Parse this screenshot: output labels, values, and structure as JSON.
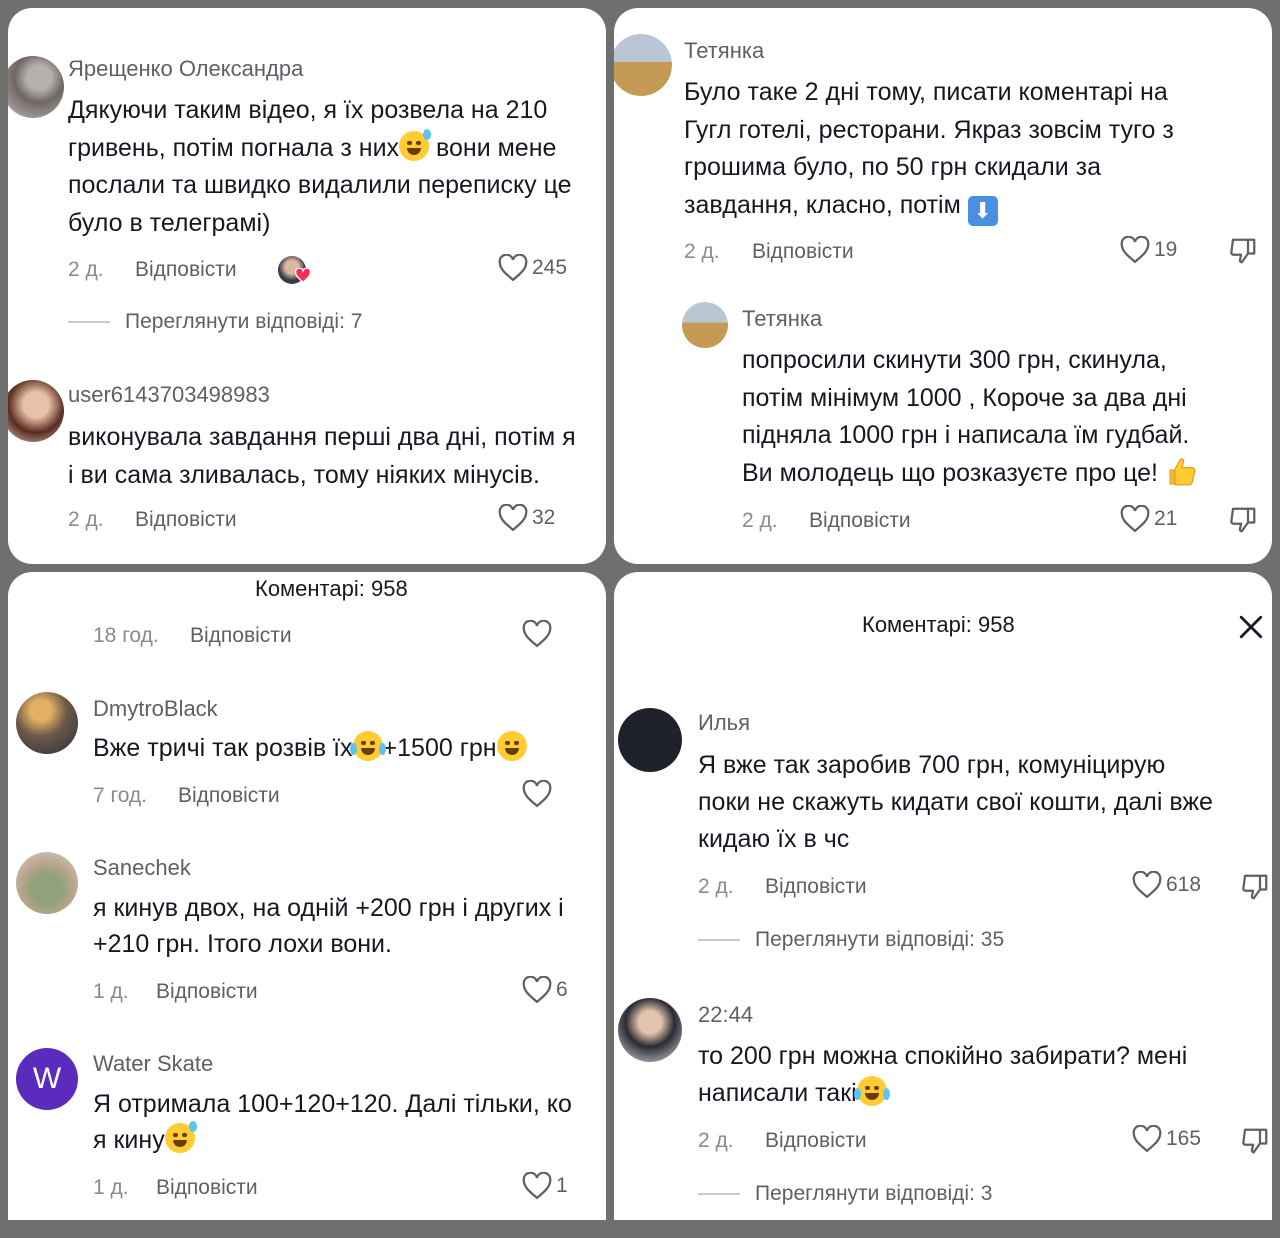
{
  "panel1": {
    "c1": {
      "username": "Ярещенко Олександра",
      "lines": [
        "Дякуючи таким відео, я їх розвела на 210",
        "гривень, потім погнала з них",
        " вони мене",
        "послали та швидко видалили переписку це",
        "було в телеграмі)"
      ],
      "time": "2 д.",
      "reply": "Відповісти",
      "likes": "245",
      "view_replies": "Переглянути відповіді: 7"
    },
    "c2": {
      "username": "user6143703498983",
      "lines": [
        "виконувала завдання перші два дні, потім я",
        "і ви сама зливалась, тому ніяких мінусів."
      ],
      "time": "2 д.",
      "reply": "Відповісти",
      "likes": "32"
    }
  },
  "panel2": {
    "c1": {
      "username": "Тетянка",
      "lines": [
        "Було таке 2 дні тому, писати коментарі на",
        "Гугл готелі, ресторани. Якраз зовсім туго з",
        "грошима було, по 50 грн скидали за",
        "завдання, класно, потім "
      ],
      "time": "2 д.",
      "reply": "Відповісти",
      "likes": "19"
    },
    "c2": {
      "username": "Тетянка",
      "lines": [
        "попросили скинути 300 грн, скинула,",
        "потім мінімум 1000 , Короче за два дні",
        "підняла 1000 грн і написала їм гудбай.",
        "Ви молодець що розказуєте про це! "
      ],
      "time": "2 д.",
      "reply": "Відповісти",
      "likes": "21"
    }
  },
  "panel3": {
    "header": "Коментарі: 958",
    "top": {
      "time": "18 год.",
      "reply": "Відповісти"
    },
    "c1": {
      "username": "DmytroBlack",
      "text_a": "Вже тричі так розвів їх",
      "text_b": "+1500 грн",
      "time": "7 год.",
      "reply": "Відповісти"
    },
    "c2": {
      "username": "Sanechek",
      "lines": [
        "я кинув двох, на одній +200 грн і других і",
        "+210 грн. Ітого лохи вони."
      ],
      "time": "1 д.",
      "reply": "Відповісти",
      "likes": "6"
    },
    "c3": {
      "username": "Water Skate",
      "avatar_letter": "W",
      "lines": [
        "Я отримала 100+120+120. Далі тільки, ко",
        "я кину"
      ],
      "time": "1 д.",
      "reply": "Відповісти",
      "likes": "1"
    }
  },
  "panel4": {
    "header": "Коментарі: 958",
    "c1": {
      "username": "Илья",
      "lines": [
        "Я вже так заробив 700 грн, комуніцирую",
        "поки не скажуть кидати свої кошти, далі вже",
        "кидаю їх в чс"
      ],
      "time": "2 д.",
      "reply": "Відповісти",
      "likes": "618",
      "view_replies": "Переглянути відповіді: 35"
    },
    "c2": {
      "username": "22:44",
      "lines": [
        "то 200 грн можна спокійно забирати? мені",
        "написали такі"
      ],
      "time": "2 д.",
      "reply": "Відповісти",
      "likes": "165",
      "view_replies": "Переглянути відповіді: 3"
    }
  },
  "icons": {
    "like": "heart-outline-icon",
    "dislike": "thumb-down-icon",
    "close": "close-icon",
    "down_arrow": "down-arrow-emoji",
    "thumbs_up": "thumbs-up-emoji"
  },
  "colors": {
    "avatar_w": "#5b2bbd",
    "heart_red": "#fe2c55"
  }
}
